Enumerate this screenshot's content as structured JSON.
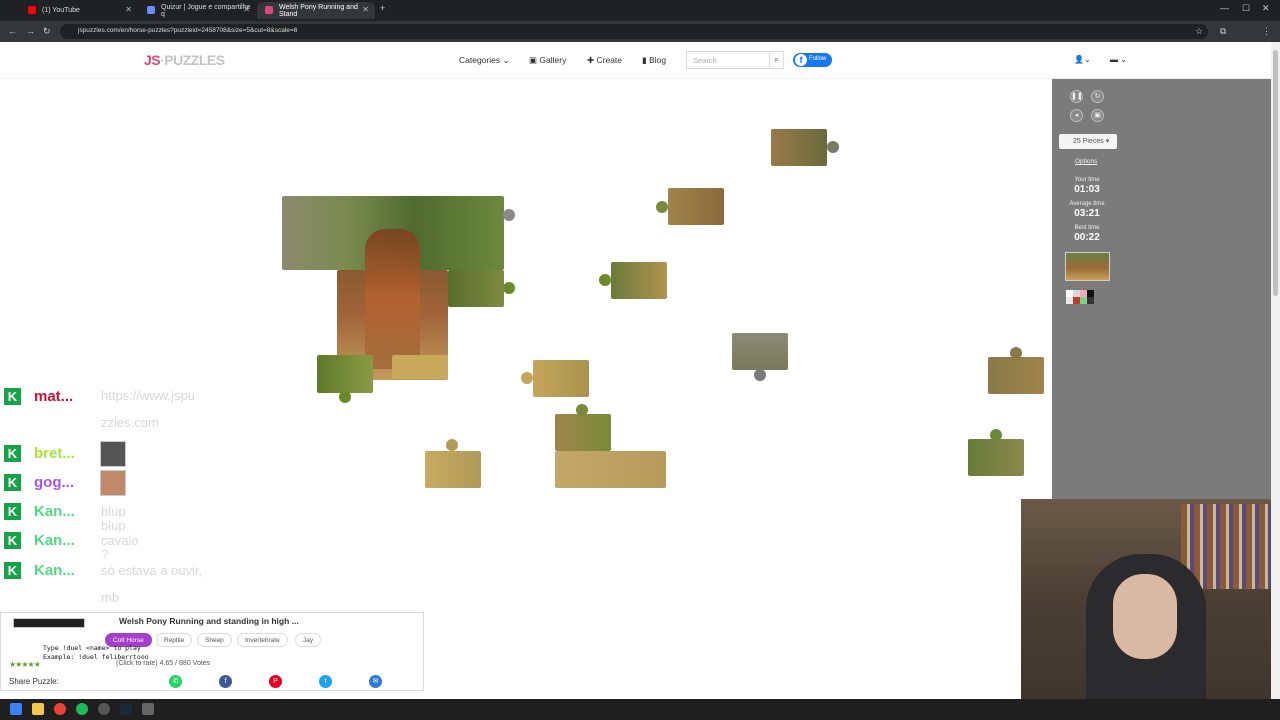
{
  "browser": {
    "tabs": [
      {
        "title": "(1) YouTube",
        "color": "#ff0000"
      },
      {
        "title": "Quizur | Jogue e compartilhe q",
        "color": "#6b8cff"
      },
      {
        "title": "Welsh Pony Running and Stand",
        "color": "#e0457b"
      }
    ],
    "new_tab": "+",
    "url": "jspuzzles.com/en/horse-puzzles?puzzleid=2458708&size=5&cut=8&scale=6"
  },
  "header": {
    "logo": "JS",
    "logo_rest": "PUZZLES",
    "nav": {
      "categories": "Categories",
      "gallery": "Gallery",
      "create": "Create",
      "blog": "Blog"
    },
    "search_placeholder": "Search",
    "follow": "Follow"
  },
  "sidebar": {
    "pieces_label": "25 Pieces",
    "options": "Options",
    "your_time_label": "Your time",
    "your_time": "01:03",
    "avg_time_label": "Average time",
    "avg_time": "03:21",
    "best_time_label": "Best time",
    "best_time": "00:22",
    "swatches": [
      "#ffffff",
      "#d8d8d8",
      "#f4a6c0",
      "#111111",
      "#e8e8e8",
      "#c0392b",
      "#7fd17f",
      "#333333"
    ]
  },
  "chat": [
    {
      "user": "mat...",
      "color": "#cc1133",
      "msg": "https://www.jspu zzles.com",
      "avatar": false
    },
    {
      "user": "bret...",
      "color": "#a3e635",
      "msg": "",
      "avatar": true
    },
    {
      "user": "gog...",
      "color": "#a855f7",
      "msg": "",
      "avatar": true
    },
    {
      "user": "Kan...",
      "color": "#4ade80",
      "msg": "blup blup",
      "avatar": false
    },
    {
      "user": "Kan...",
      "color": "#4ade80",
      "msg": "cavalo ?",
      "avatar": false
    },
    {
      "user": "Kan...",
      "color": "#4ade80",
      "msg": "só estava a ouvir, mb",
      "avatar": false
    }
  ],
  "puzzle_info": {
    "title": "Welsh Pony Running and standing in high ...",
    "tags": [
      "Colt Horse",
      "Reptile",
      "Sheep",
      "Invertebrate",
      "Jay"
    ],
    "active_tag": "Colt Horse",
    "click_to_rate": "(Click to rate)",
    "rating": "4.65 / 880 Votes",
    "stars": "★★★★★",
    "share_label": "Share Puzzle:",
    "overlay_lines": [
      "Type !duel <name> to play",
      "Example: !duel feliberrtooo"
    ]
  }
}
